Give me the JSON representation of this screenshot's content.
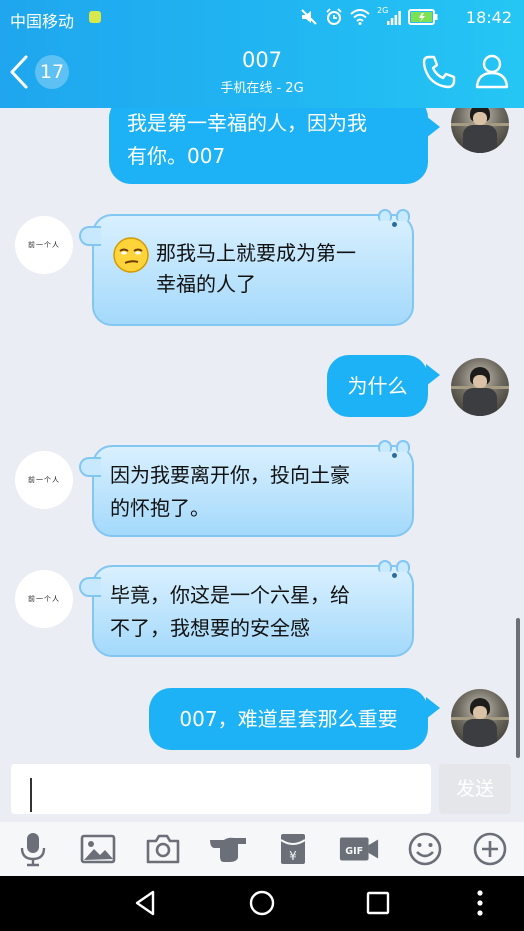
{
  "status_bar": {
    "carrier": "中国移动",
    "network_label": "2G",
    "time": "18:42"
  },
  "header": {
    "unread_count": "17",
    "contact_name": "007",
    "contact_status": "手机在线 - 2G"
  },
  "messages": [
    {
      "side": "right",
      "type": "text",
      "text": "我是第一幸福的人，因为我\n有你。007"
    },
    {
      "side": "left",
      "type": "hippo",
      "emoji": "smirk-face-icon",
      "text": "那我马上就要成为第一\n幸福的人了"
    },
    {
      "side": "right",
      "type": "text",
      "text": "为什么"
    },
    {
      "side": "left",
      "type": "hippo",
      "text": "因为我要离开你，投向土豪\n的怀抱了。"
    },
    {
      "side": "left",
      "type": "hippo",
      "text": "毕竟，你这是一个六星，给\n不了，我想要的安全感"
    },
    {
      "side": "right",
      "type": "text",
      "text": "007，难道星套那么重要"
    }
  ],
  "left_avatar_text": "前一个人",
  "input": {
    "value": "",
    "send_label": "发送"
  },
  "toolbar": [
    "microphone-icon",
    "image-icon",
    "camera-icon",
    "poke-icon",
    "red-packet-icon",
    "gif-icon",
    "emoji-icon",
    "plus-icon"
  ],
  "colors": {
    "header": "#21b6f2",
    "bubble": "#1cb2f5",
    "hippo_bubble": "#b6e1fc",
    "chat_background": "#eaedf4"
  }
}
